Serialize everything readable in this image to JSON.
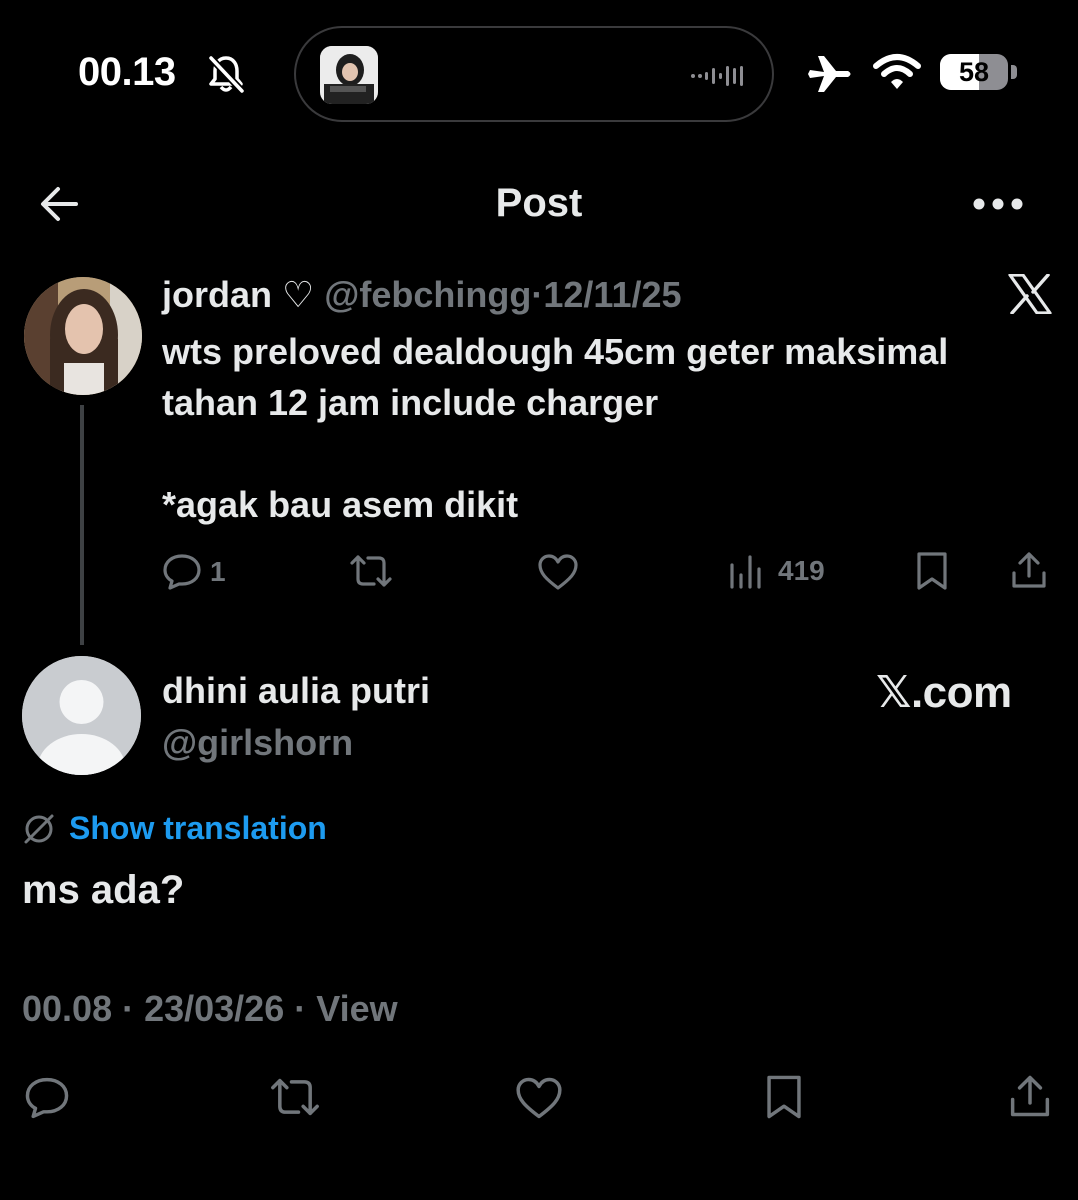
{
  "status_bar": {
    "time": "00.13",
    "bell_icon": "bell-slash-icon",
    "airplane_icon": "airplane-icon",
    "wifi_icon": "wifi-icon",
    "battery_level": 58,
    "battery_label": "58"
  },
  "nav": {
    "back_icon": "arrow-left-icon",
    "title": "Post",
    "more_icon": "more-horizontal-icon"
  },
  "original_post": {
    "author_name": "jordan ♡",
    "handle": "@febchingg",
    "separator": "·",
    "date": "12/11/25",
    "body": "wts preloved dealdough 45cm geter maksimal\ntahan 12 jam include charger\n\n*agak bau asem dikit",
    "actions": {
      "reply_count": "1",
      "views_count": "419"
    }
  },
  "reply_post": {
    "author_name": "dhini aulia putri",
    "handle": "@girlshorn",
    "source": "𝕏.com",
    "translation_link": "Show translation",
    "text": "ms ada?",
    "meta": "00.08 · 23/03/26 · View"
  },
  "colors": {
    "background": "#000000",
    "text_primary": "#e7e9ea",
    "text_secondary": "#71767b",
    "accent": "#1d9bf0",
    "thread_line": "#3e4144"
  }
}
